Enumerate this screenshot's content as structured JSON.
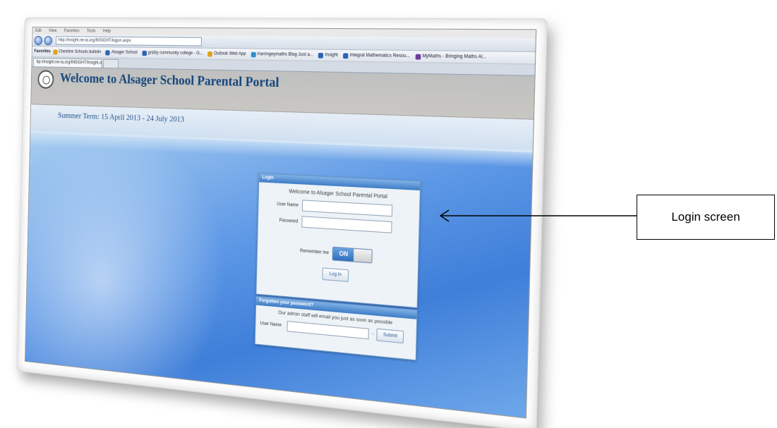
{
  "browser": {
    "menu_items": [
      "Edit",
      "View",
      "Favorites",
      "Tools",
      "Help"
    ],
    "url": "http://insight.ne-ia.org/INSIGHT/logon.aspx",
    "favorites_label": "Favorites",
    "favorites": [
      {
        "label": "Cheshire Schools bulletin",
        "color": "#e0a21b"
      },
      {
        "label": "Alsager School",
        "color": "#2e63b5"
      },
      {
        "label": "grizby community college - G...",
        "color": "#2e63b5"
      },
      {
        "label": "Outlook Web App",
        "color": "#e0a21b"
      },
      {
        "label": "Harringeymaths Blog Just a...",
        "color": "#2f8fd0"
      },
      {
        "label": "Insight",
        "color": "#2e63b5"
      },
      {
        "label": "Integral Mathematics Resou...",
        "color": "#2e63b5"
      },
      {
        "label": "MyMaths - Bringing Maths Al...",
        "color": "#6a3d9a"
      }
    ],
    "tab_title": "ttp://insight.ne-ia.org/INSIGHT/Insight.aspx"
  },
  "portal": {
    "title": "Welcome to Alsager School Parental Portal",
    "term": "Summer Term: 15 April 2013 - 24 July 2013",
    "crest_text": "ALSAGER SCHOOL"
  },
  "login": {
    "header": "Login",
    "welcome": "Welcome to Alsager School Parental Portal",
    "username_label": "User Name",
    "password_label": "Password",
    "remember_label": "Remember me",
    "toggle_on": "ON",
    "login_button": "Log In"
  },
  "forgot": {
    "header": "Forgotten your password?",
    "note": "Our admin staff will email you just as soon as possible",
    "username_label": "User Name",
    "dash": "-",
    "submit_button": "Submit"
  },
  "callout": {
    "text": "Login screen"
  }
}
